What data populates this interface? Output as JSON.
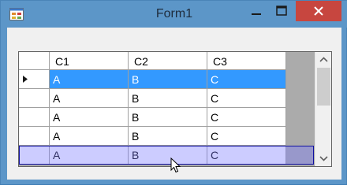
{
  "window": {
    "title": "Form1",
    "colors": {
      "titlebar": "#5c96c8",
      "close": "#c7463f",
      "selection": "#3399ff"
    }
  },
  "grid": {
    "columns": [
      "C1",
      "C2",
      "C3"
    ],
    "rows": [
      [
        "A",
        "B",
        "C"
      ],
      [
        "A",
        "B",
        "C"
      ],
      [
        "A",
        "B",
        "C"
      ],
      [
        "A",
        "B",
        "C"
      ],
      [
        "A",
        "B",
        "C"
      ]
    ],
    "selected_row": 0,
    "current_row_indicator": "row-arrow-icon",
    "hover_highlight_row": 4
  },
  "icons": [
    "app-icon",
    "minimize-icon",
    "maximize-icon",
    "close-icon",
    "scroll-up-icon",
    "scroll-down-icon",
    "cursor-icon"
  ]
}
